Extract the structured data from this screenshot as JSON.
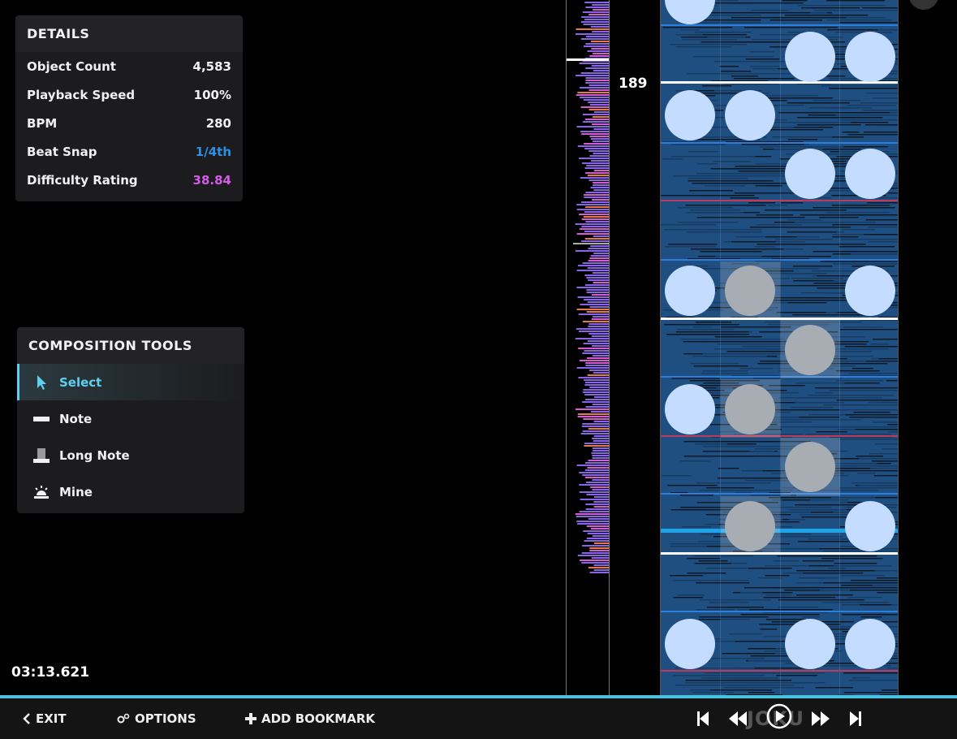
{
  "details": {
    "title": "DETAILS",
    "rows": [
      {
        "label": "Object Count",
        "value": "4,583",
        "color": "#f0f0f0"
      },
      {
        "label": "Playback Speed",
        "value": "100%",
        "color": "#f0f0f0"
      },
      {
        "label": "BPM",
        "value": "280",
        "color": "#f0f0f0"
      },
      {
        "label": "Beat Snap",
        "value": "1/4th",
        "color": "#2f8fe6"
      },
      {
        "label": "Difficulty Rating",
        "value": "38.84",
        "color": "#d45ce8"
      }
    ]
  },
  "tools": {
    "title": "COMPOSITION TOOLS",
    "items": [
      {
        "label": "Select",
        "icon": "cursor-icon",
        "active": true
      },
      {
        "label": "Note",
        "icon": "note-icon",
        "active": false
      },
      {
        "label": "Long Note",
        "icon": "long-note-icon",
        "active": false
      },
      {
        "label": "Mine",
        "icon": "mine-icon",
        "active": false
      }
    ]
  },
  "timecode": "03:13.621",
  "measure_number": "189",
  "bottom_bar": {
    "exit_label": "EXIT",
    "options_label": "OPTIONS",
    "bookmark_label": "ADD BOOKMARK",
    "logo_text": "JOKU"
  },
  "colors": {
    "accent": "#49c1dc",
    "note": "#c4dcff",
    "beat_snap": "#2f8fe6",
    "difficulty": "#d45ce8"
  }
}
